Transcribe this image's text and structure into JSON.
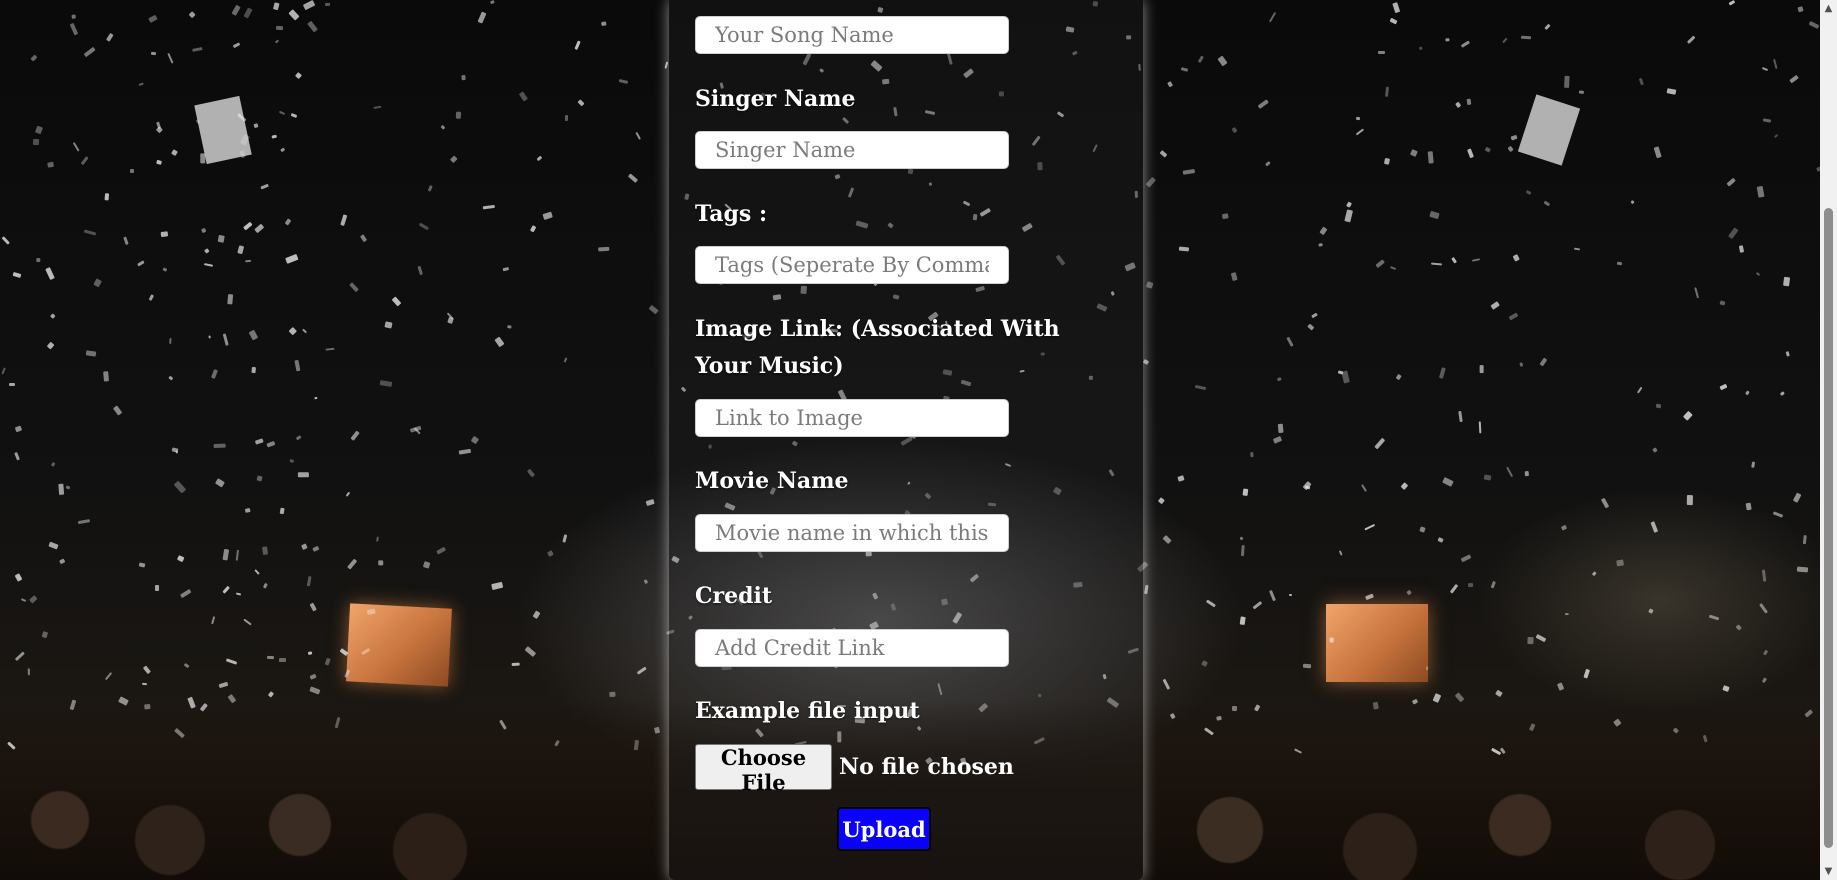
{
  "form": {
    "fields": [
      {
        "label": "",
        "placeholder": "Your Song Name"
      },
      {
        "label": "Singer Name",
        "placeholder": "Singer Name"
      },
      {
        "label": "Tags :",
        "placeholder": "Tags (Seperate By Commas)"
      },
      {
        "label": "Image Link: (Associated With Your Music)",
        "placeholder": "Link to Image"
      },
      {
        "label": "Movie Name",
        "placeholder": "Movie name in which this song appeared"
      },
      {
        "label": "Credit",
        "placeholder": "Add Credit Link"
      }
    ],
    "file_input": {
      "label": "Example file input",
      "button_label": "Choose File",
      "status": "No file chosen"
    },
    "upload_label": "Upload"
  },
  "colors": {
    "upload_button": "#0a00ff",
    "panel_glow": "#ffffff",
    "background": "#050505"
  },
  "icons": {
    "scroll_up": "triangle-up",
    "scroll_down": "triangle-down"
  }
}
